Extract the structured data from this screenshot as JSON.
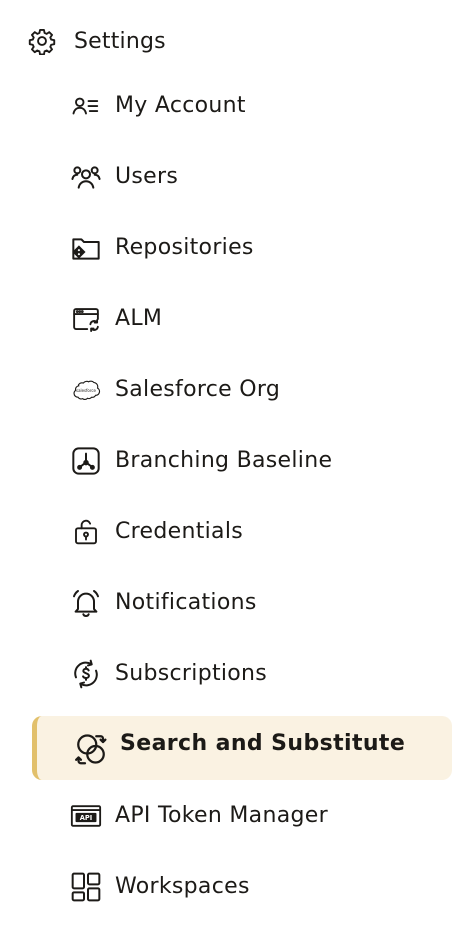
{
  "header": {
    "icon": "gear-icon",
    "title": "Settings"
  },
  "nav": {
    "active_index": 9,
    "active_colors": {
      "background": "#faf2e2",
      "accent_bar": "#e2c06b"
    },
    "items": [
      {
        "label": "My Account",
        "icon": "user-list-icon"
      },
      {
        "label": "Users",
        "icon": "users-icon"
      },
      {
        "label": "Repositories",
        "icon": "repository-folder-icon"
      },
      {
        "label": "ALM",
        "icon": "alm-window-icon"
      },
      {
        "label": "Salesforce Org",
        "icon": "salesforce-cloud-icon",
        "icon_text": "salesforce"
      },
      {
        "label": "Branching Baseline",
        "icon": "branch-icon"
      },
      {
        "label": "Credentials",
        "icon": "unlock-icon"
      },
      {
        "label": "Notifications",
        "icon": "bell-icon"
      },
      {
        "label": "Subscriptions",
        "icon": "subscription-dollar-icon"
      },
      {
        "label": "Search and Substitute",
        "icon": "search-substitute-icon"
      },
      {
        "label": "API Token Manager",
        "icon": "api-token-icon",
        "icon_text": "API"
      },
      {
        "label": "Workspaces",
        "icon": "workspaces-grid-icon"
      }
    ]
  }
}
